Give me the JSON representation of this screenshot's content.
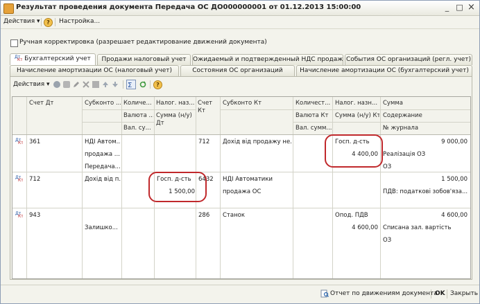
{
  "window": {
    "title": "Результат проведения документа Передача ОС ДО000000001 от 01.12.2013 15:00:00",
    "minimize": "_",
    "maximize": "□",
    "close": "×"
  },
  "menu": {
    "actions": "Действия ▾",
    "settings": "Настройка..."
  },
  "manual_correction": {
    "label": "Ручная корректировка (разрешает редактирование движений документа)",
    "checked": false
  },
  "tabs_row1": [
    "Бухгалтерский учет",
    "Продажи налоговый учет",
    "Ожидаемый и подтвержденный НДС продаж",
    "События ОС организаций (регл. учет)"
  ],
  "tabs_row2": [
    "Начисление амортизации ОС (налоговый учет)",
    "Состояния ОС организаций",
    "Начисление амортизации ОС (бухгалтерский учет)"
  ],
  "toolbar": {
    "actions": "Действия ▾"
  },
  "grid": {
    "headers": {
      "schet_dt": "Счет Дт",
      "subkonto_dt": "Субконто ...",
      "kolich_dt": "Количе...",
      "valuta_dt": "Валюта ...",
      "val_su_dt": "Вал. су...",
      "nalog_naz_dt": "Налог. наз...",
      "summa_nu_dt": "Сумма (н/у)",
      "dt": "Дт",
      "schet_kt": "Счет",
      "kt": "Кт",
      "subkonto_kt": "Субконто Кт",
      "kolich_kt": "Количест...",
      "valuta_kt": "Валюта Кт",
      "val_summ_kt": "Вал. сумм...",
      "nalog_naz_kt": "Налог. назн...",
      "summa_nu_kt": "Сумма (н/у) Кт",
      "summa": "Сумма",
      "soderzhanie": "Содержание",
      "journal": "№ журнала"
    },
    "rows": [
      {
        "schet_dt": "361",
        "subkonto_dt": [
          "НДІ Автом...",
          "продажа ...",
          "Передача..."
        ],
        "schet_kt": "712",
        "subkonto_kt": [
          "Дохід від продажу не..."
        ],
        "nalog_naz_kt": "Госп. д-сть",
        "summa_nu_kt": "4 400,00",
        "summa": "9 000,00",
        "soderzhanie": "Реалізація ОЗ",
        "journal": "ОЗ"
      },
      {
        "schet_dt": "712",
        "subkonto_dt": [
          "Дохід від п..."
        ],
        "nalog_naz_dt": "Госп. д-сть",
        "summa_nu_dt": "1 500,00",
        "schet_kt": "6432",
        "subkonto_kt": [
          "НДІ Автоматики",
          "продажа ОС"
        ],
        "summa": "1 500,00",
        "soderzhanie": "ПДВ: податкові зобов'яза...",
        "journal": ""
      },
      {
        "schet_dt": "943",
        "subkonto_dt": [
          "",
          "Залишко..."
        ],
        "schet_kt": "286",
        "subkonto_kt": [
          "Станок"
        ],
        "nalog_naz_kt": "Опод. ПДВ",
        "summa_nu_kt": "4 600,00",
        "summa": "4 600,00",
        "soderzhanie": "Списана зал. вартість",
        "journal": "ОЗ"
      }
    ]
  },
  "status": {
    "report": "Отчет по движениям документа",
    "ok": "OK",
    "close": "Закрыть"
  },
  "colors": {
    "annotation": "#c0282b",
    "window_bg": "#f3f3ec",
    "grid_bg": "#ffffff"
  }
}
